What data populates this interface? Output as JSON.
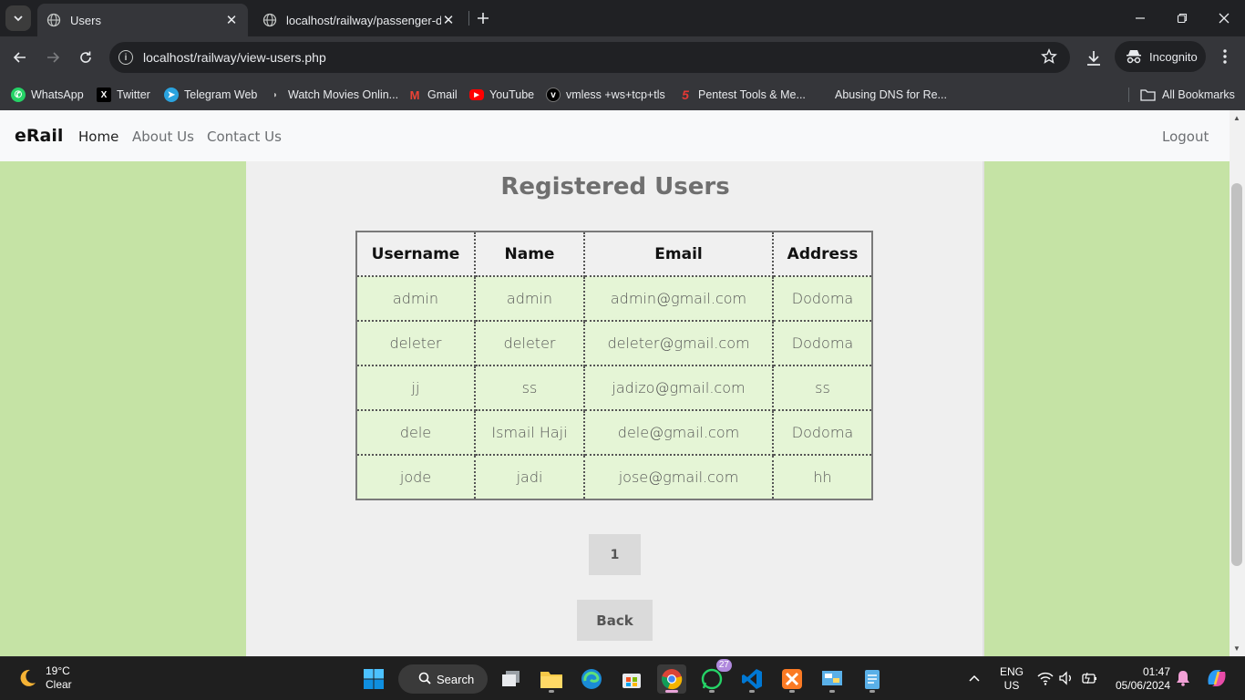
{
  "browser": {
    "tabs": [
      {
        "title": "Users",
        "active": true
      },
      {
        "title": "localhost/railway/passenger-de",
        "active": false
      }
    ],
    "url": "localhost/railway/view-users.php",
    "incognito_label": "Incognito",
    "bookmarks": [
      {
        "label": "WhatsApp",
        "icon": "whatsapp-icon"
      },
      {
        "label": "Twitter",
        "icon": "x-twitter-icon"
      },
      {
        "label": "Telegram Web",
        "icon": "telegram-icon"
      },
      {
        "label": "Watch Movies Onlin...",
        "icon": "movie-site-icon"
      },
      {
        "label": "Gmail",
        "icon": "gmail-icon"
      },
      {
        "label": "YouTube",
        "icon": "youtube-icon"
      },
      {
        "label": "vmless +ws+tcp+tls",
        "icon": "vmless-icon"
      },
      {
        "label": "Pentest Tools & Me...",
        "icon": "pentest-icon"
      },
      {
        "label": "Abusing DNS for Re...",
        "icon": ""
      }
    ],
    "all_bookmarks_label": "All Bookmarks"
  },
  "page": {
    "brand": "eRail",
    "nav": {
      "home": "Home",
      "about": "About Us",
      "contact": "Contact Us",
      "logout": "Logout"
    },
    "title": "Registered Users",
    "table": {
      "headers": [
        "Username",
        "Name",
        "Email",
        "Address"
      ],
      "rows": [
        [
          "admin",
          "admin",
          "admin@gmail.com",
          "Dodoma"
        ],
        [
          "deleter",
          "deleter",
          "deleter@gmail.com",
          "Dodoma"
        ],
        [
          "jj",
          "ss",
          "jadizo@gmail.com",
          "ss"
        ],
        [
          "dele",
          "Ismail Haji",
          "dele@gmail.com",
          "Dodoma"
        ],
        [
          "jode",
          "jadi",
          "jose@gmail.com",
          "hh"
        ]
      ]
    },
    "pagination": {
      "current_page": "1"
    },
    "back_label": "Back"
  },
  "taskbar": {
    "weather": {
      "temp": "19°C",
      "condition": "Clear"
    },
    "search_label": "Search",
    "whatsapp_badge": "27",
    "lang": {
      "line1": "ENG",
      "line2": "US"
    },
    "time": "01:47",
    "date": "05/06/2024"
  },
  "colors": {
    "page_background": "#c5e3a5",
    "panel_background": "#efefef",
    "table_cell_background": "#e5f5d6",
    "browser_dark": "#202124",
    "browser_toolbar": "#35363a"
  }
}
